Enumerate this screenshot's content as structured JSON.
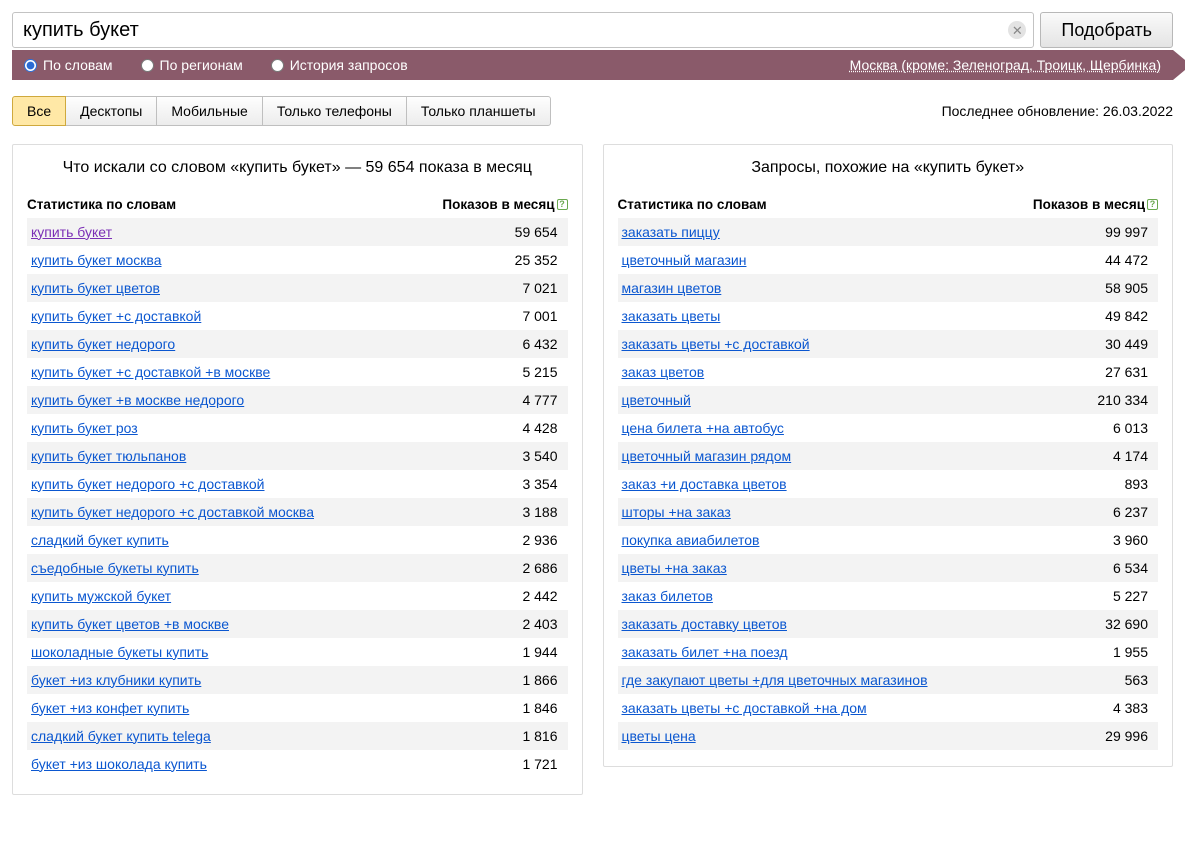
{
  "search": {
    "value": "купить букет",
    "submit_label": "Подобрать"
  },
  "modes": {
    "by_words": "По словам",
    "by_regions": "По регионам",
    "history": "История запросов",
    "region_label": "Москва (кроме: Зеленоград, Троицк, Щербинка)"
  },
  "tabs": {
    "all": "Все",
    "desktop": "Десктопы",
    "mobile": "Мобильные",
    "phones": "Только телефоны",
    "tablets": "Только планшеты"
  },
  "updated_label": "Последнее обновление: 26.03.2022",
  "left": {
    "title": "Что искали со словом «купить букет» — 59 654 показа в месяц",
    "col1": "Статистика по словам",
    "col2": "Показов в месяц",
    "rows": [
      {
        "q": "купить букет",
        "n": "59 654",
        "visited": true
      },
      {
        "q": "купить букет москва",
        "n": "25 352"
      },
      {
        "q": "купить букет цветов",
        "n": "7 021"
      },
      {
        "q": "купить букет +с доставкой",
        "n": "7 001"
      },
      {
        "q": "купить букет недорого",
        "n": "6 432"
      },
      {
        "q": "купить букет +с доставкой +в москве",
        "n": "5 215"
      },
      {
        "q": "купить букет +в москве недорого",
        "n": "4 777"
      },
      {
        "q": "купить букет роз",
        "n": "4 428"
      },
      {
        "q": "купить букет тюльпанов",
        "n": "3 540"
      },
      {
        "q": "купить букет недорого +с доставкой",
        "n": "3 354"
      },
      {
        "q": "купить букет недорого +с доставкой москва",
        "n": "3 188"
      },
      {
        "q": "сладкий букет купить",
        "n": "2 936"
      },
      {
        "q": "съедобные букеты купить",
        "n": "2 686"
      },
      {
        "q": "купить мужской букет",
        "n": "2 442"
      },
      {
        "q": "купить букет цветов +в москве",
        "n": "2 403"
      },
      {
        "q": "шоколадные букеты купить",
        "n": "1 944"
      },
      {
        "q": "букет +из клубники купить",
        "n": "1 866"
      },
      {
        "q": "букет +из конфет купить",
        "n": "1 846"
      },
      {
        "q": "сладкий букет купить telega",
        "n": "1 816"
      },
      {
        "q": "букет +из шоколада купить",
        "n": "1 721"
      }
    ]
  },
  "right": {
    "title": "Запросы, похожие на «купить букет»",
    "col1": "Статистика по словам",
    "col2": "Показов в месяц",
    "rows": [
      {
        "q": "заказать пиццу",
        "n": "99 997"
      },
      {
        "q": "цветочный магазин",
        "n": "44 472"
      },
      {
        "q": "магазин цветов",
        "n": "58 905"
      },
      {
        "q": "заказать цветы",
        "n": "49 842"
      },
      {
        "q": "заказать цветы +с доставкой",
        "n": "30 449"
      },
      {
        "q": "заказ цветов",
        "n": "27 631"
      },
      {
        "q": "цветочный",
        "n": "210 334"
      },
      {
        "q": "цена билета +на автобус",
        "n": "6 013"
      },
      {
        "q": "цветочный магазин рядом",
        "n": "4 174"
      },
      {
        "q": "заказ +и доставка цветов",
        "n": "893"
      },
      {
        "q": "шторы +на заказ",
        "n": "6 237"
      },
      {
        "q": "покупка авиабилетов",
        "n": "3 960"
      },
      {
        "q": "цветы +на заказ",
        "n": "6 534"
      },
      {
        "q": "заказ билетов",
        "n": "5 227"
      },
      {
        "q": "заказать доставку цветов",
        "n": "32 690"
      },
      {
        "q": "заказать билет +на поезд",
        "n": "1 955"
      },
      {
        "q": "где закупают цветы +для цветочных магазинов",
        "n": "563"
      },
      {
        "q": "заказать цветы +с доставкой +на дом",
        "n": "4 383"
      },
      {
        "q": "цветы цена",
        "n": "29 996"
      }
    ]
  }
}
